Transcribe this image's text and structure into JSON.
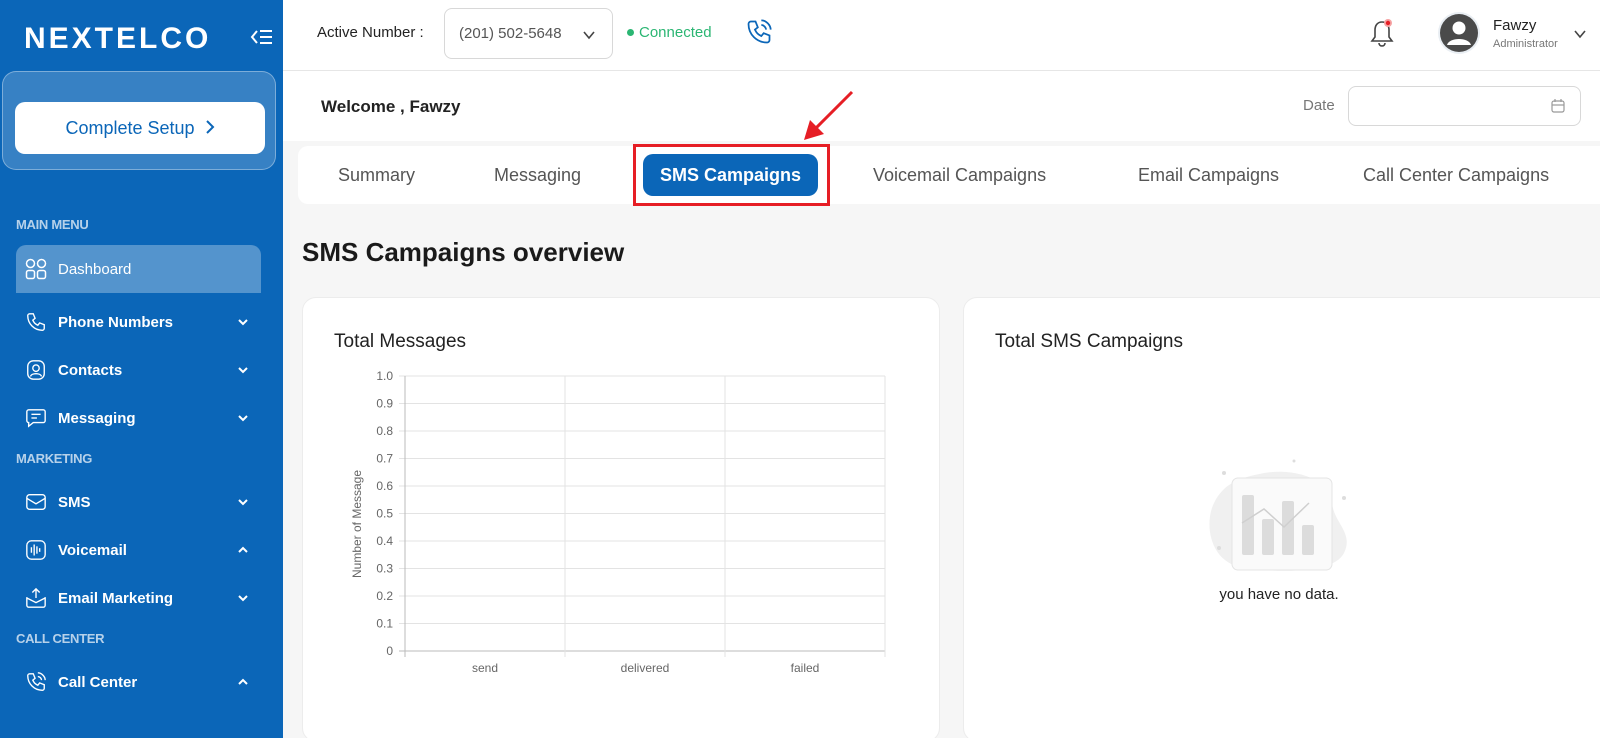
{
  "brand": {
    "logo_text": "NEXTELCO",
    "primary_color": "#0b66b8",
    "highlight_color": "#e61e25"
  },
  "sidebar": {
    "setup_button_label": "Complete Setup",
    "sections": {
      "main_menu": "MAIN MENU",
      "marketing": "MARKETING",
      "call_center": "CALL CENTER"
    },
    "items": [
      {
        "label": "Dashboard",
        "icon": "grid-icon",
        "active": true
      },
      {
        "label": "Phone Numbers",
        "icon": "phone-icon",
        "expanded": false
      },
      {
        "label": "Contacts",
        "icon": "contacts-icon",
        "expanded": false
      },
      {
        "label": "Messaging",
        "icon": "message-icon",
        "expanded": false
      },
      {
        "label": "SMS",
        "icon": "sms-icon",
        "expanded": false
      },
      {
        "label": "Voicemail",
        "icon": "voicemail-icon",
        "expanded": true
      },
      {
        "label": "Email Marketing",
        "icon": "email-icon",
        "expanded": false
      },
      {
        "label": "Call Center",
        "icon": "call-center-icon",
        "expanded": true
      }
    ]
  },
  "topbar": {
    "active_number_label": "Active Number :",
    "active_number_value": "(201) 502-5648",
    "status_text": "Connected",
    "user": {
      "name": "Fawzy",
      "role": "Administrator"
    }
  },
  "welcome": {
    "text": "Welcome , Fawzy",
    "date_label": "Date",
    "date_value": ""
  },
  "tabs": [
    {
      "label": "Summary",
      "active": false
    },
    {
      "label": "Messaging",
      "active": false
    },
    {
      "label": "SMS Campaigns",
      "active": true
    },
    {
      "label": "Voicemail Campaigns",
      "active": false
    },
    {
      "label": "Email Campaigns",
      "active": false
    },
    {
      "label": "Call Center Campaigns",
      "active": false
    }
  ],
  "overview_title": "SMS Campaigns overview",
  "cards": {
    "total_messages_title": "Total Messages",
    "total_sms_campaigns_title": "Total SMS Campaigns",
    "empty_text": "you have no data."
  },
  "chart_data": {
    "type": "bar",
    "categories": [
      "send",
      "delivered",
      "failed"
    ],
    "values": [
      0,
      0,
      0
    ],
    "ylabel": "Number of Message",
    "xlabel": "",
    "ylim": [
      0,
      1.0
    ],
    "yticks": [
      "0",
      "0.1",
      "0.2",
      "0.3",
      "0.4",
      "0.5",
      "0.6",
      "0.7",
      "0.8",
      "0.9",
      "1.0"
    ],
    "grid": true
  }
}
